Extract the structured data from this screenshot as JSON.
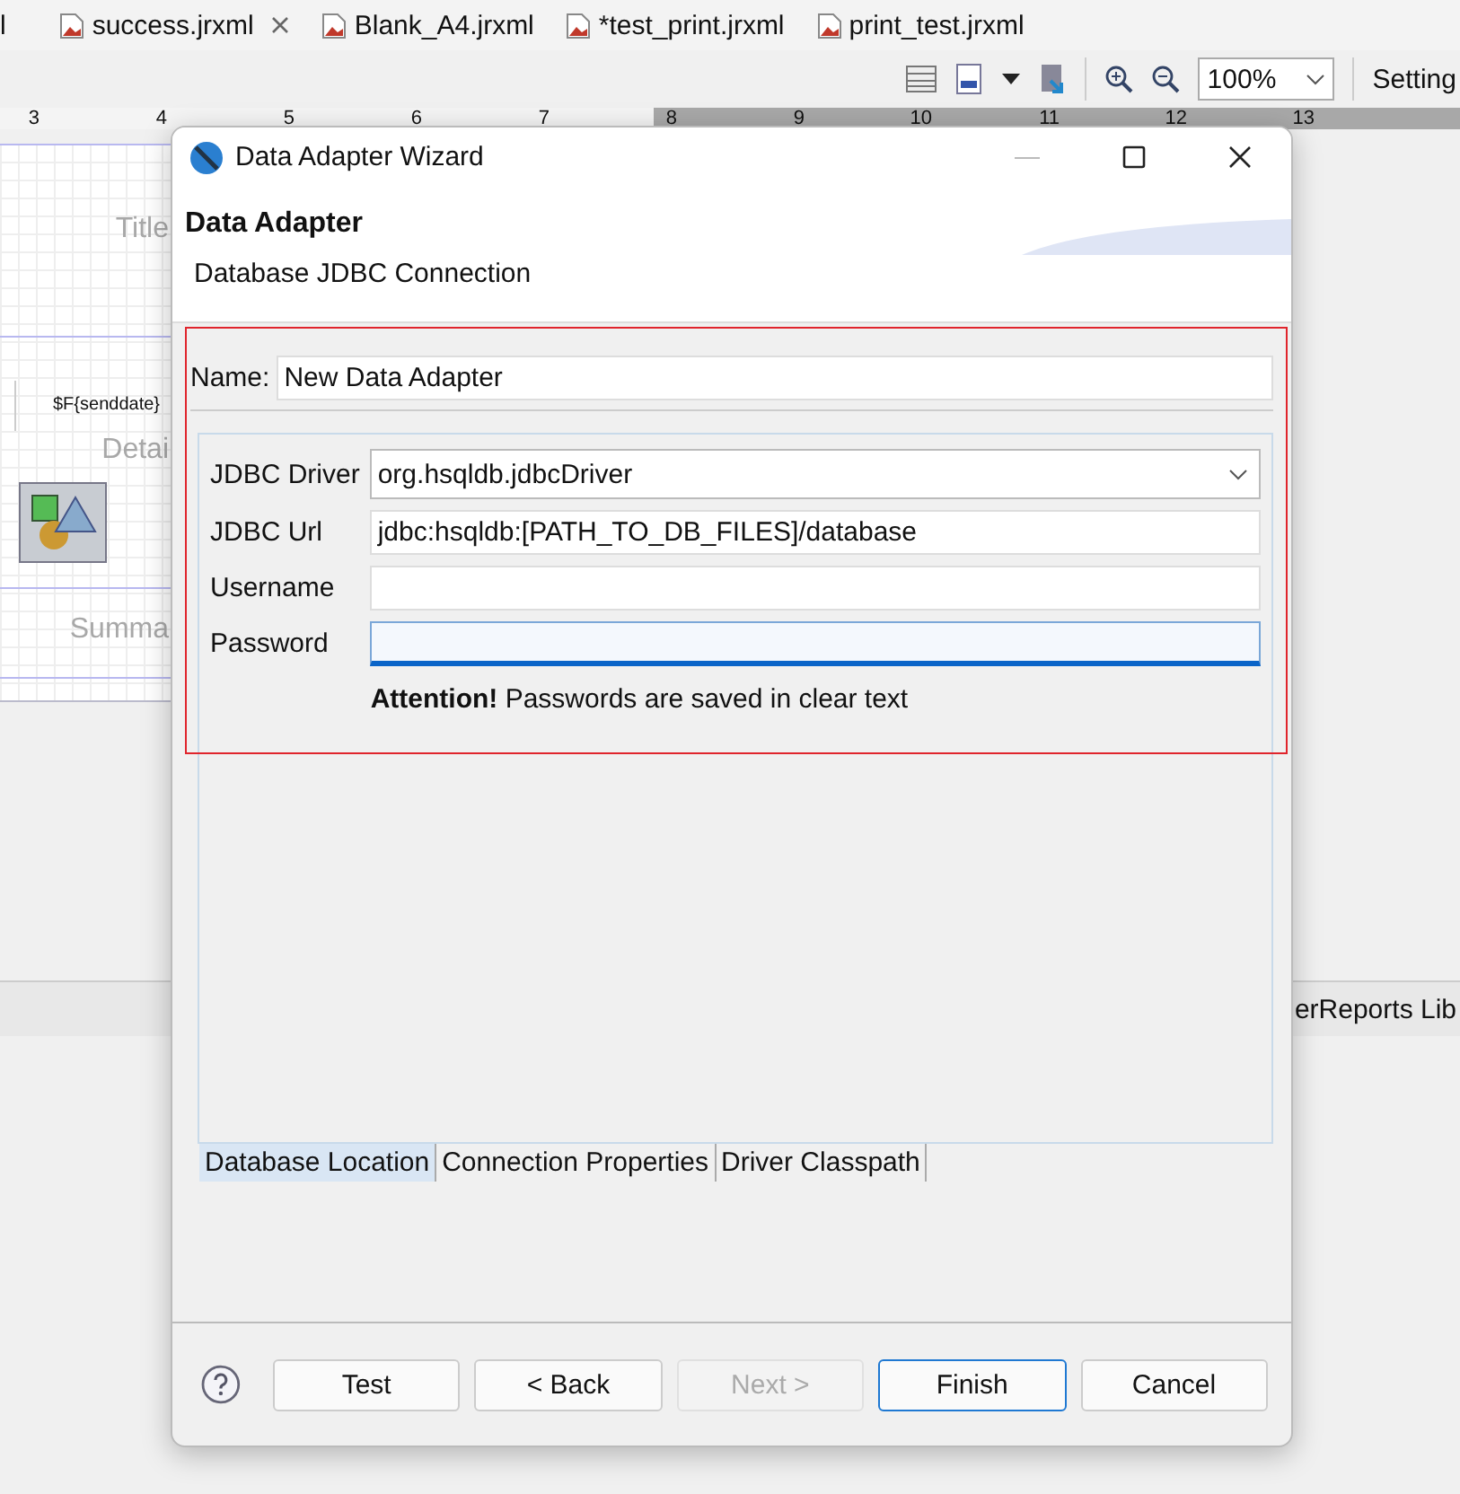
{
  "editor_tabs": [
    {
      "label": "l",
      "icon": false,
      "closable": false
    },
    {
      "label": "success.jrxml",
      "icon": true,
      "closable": true
    },
    {
      "label": "Blank_A4.jrxml",
      "icon": true,
      "closable": false
    },
    {
      "label": "*test_print.jrxml",
      "icon": true,
      "closable": false
    },
    {
      "label": "print_test.jrxml",
      "icon": true,
      "closable": false
    }
  ],
  "toolbar": {
    "zoom": "100%",
    "settings": "Setting"
  },
  "ruler": {
    "labels": [
      "3",
      "4",
      "5",
      "6",
      "7",
      "8",
      "9",
      "10",
      "11",
      "12",
      "13"
    ]
  },
  "report_canvas": {
    "bands": [
      {
        "kind": "title",
        "label": "Title"
      },
      {
        "kind": "detail",
        "label": "Detai"
      },
      {
        "kind": "summary",
        "label": "Summa"
      }
    ],
    "field": "$F{senddate}"
  },
  "bottom_panel": {
    "tab": "erReports Lib"
  },
  "dialog": {
    "title": "Data Adapter Wizard",
    "heading": "Data Adapter",
    "subtitle": "Database JDBC Connection",
    "name_label": "Name:",
    "name_value": "New Data Adapter",
    "fields": [
      {
        "kind": "combo",
        "label": "JDBC Driver",
        "value": "org.hsqldb.jdbcDriver",
        "focused": false
      },
      {
        "kind": "text",
        "label": "JDBC Url",
        "value": "jdbc:hsqldb:[PATH_TO_DB_FILES]/database",
        "focused": false
      },
      {
        "kind": "text",
        "label": "Username",
        "focused": false
      },
      {
        "kind": "text",
        "label": "Password",
        "focused": true
      }
    ],
    "note": "**Attention!** Passwords are saved in clear text",
    "tabs": [
      {
        "label": "Database Location",
        "selected": true
      },
      {
        "label": "Connection Properties",
        "selected": false
      },
      {
        "label": "Driver Classpath",
        "selected": false
      }
    ],
    "buttons": [
      {
        "label": "Test",
        "disabled": false,
        "default": false
      },
      {
        "label": "< Back",
        "disabled": false,
        "default": false
      },
      {
        "label": "Next >",
        "disabled": true,
        "default": false
      },
      {
        "label": "Finish",
        "disabled": false,
        "default": true
      },
      {
        "label": "Cancel",
        "disabled": false,
        "default": false
      }
    ]
  }
}
